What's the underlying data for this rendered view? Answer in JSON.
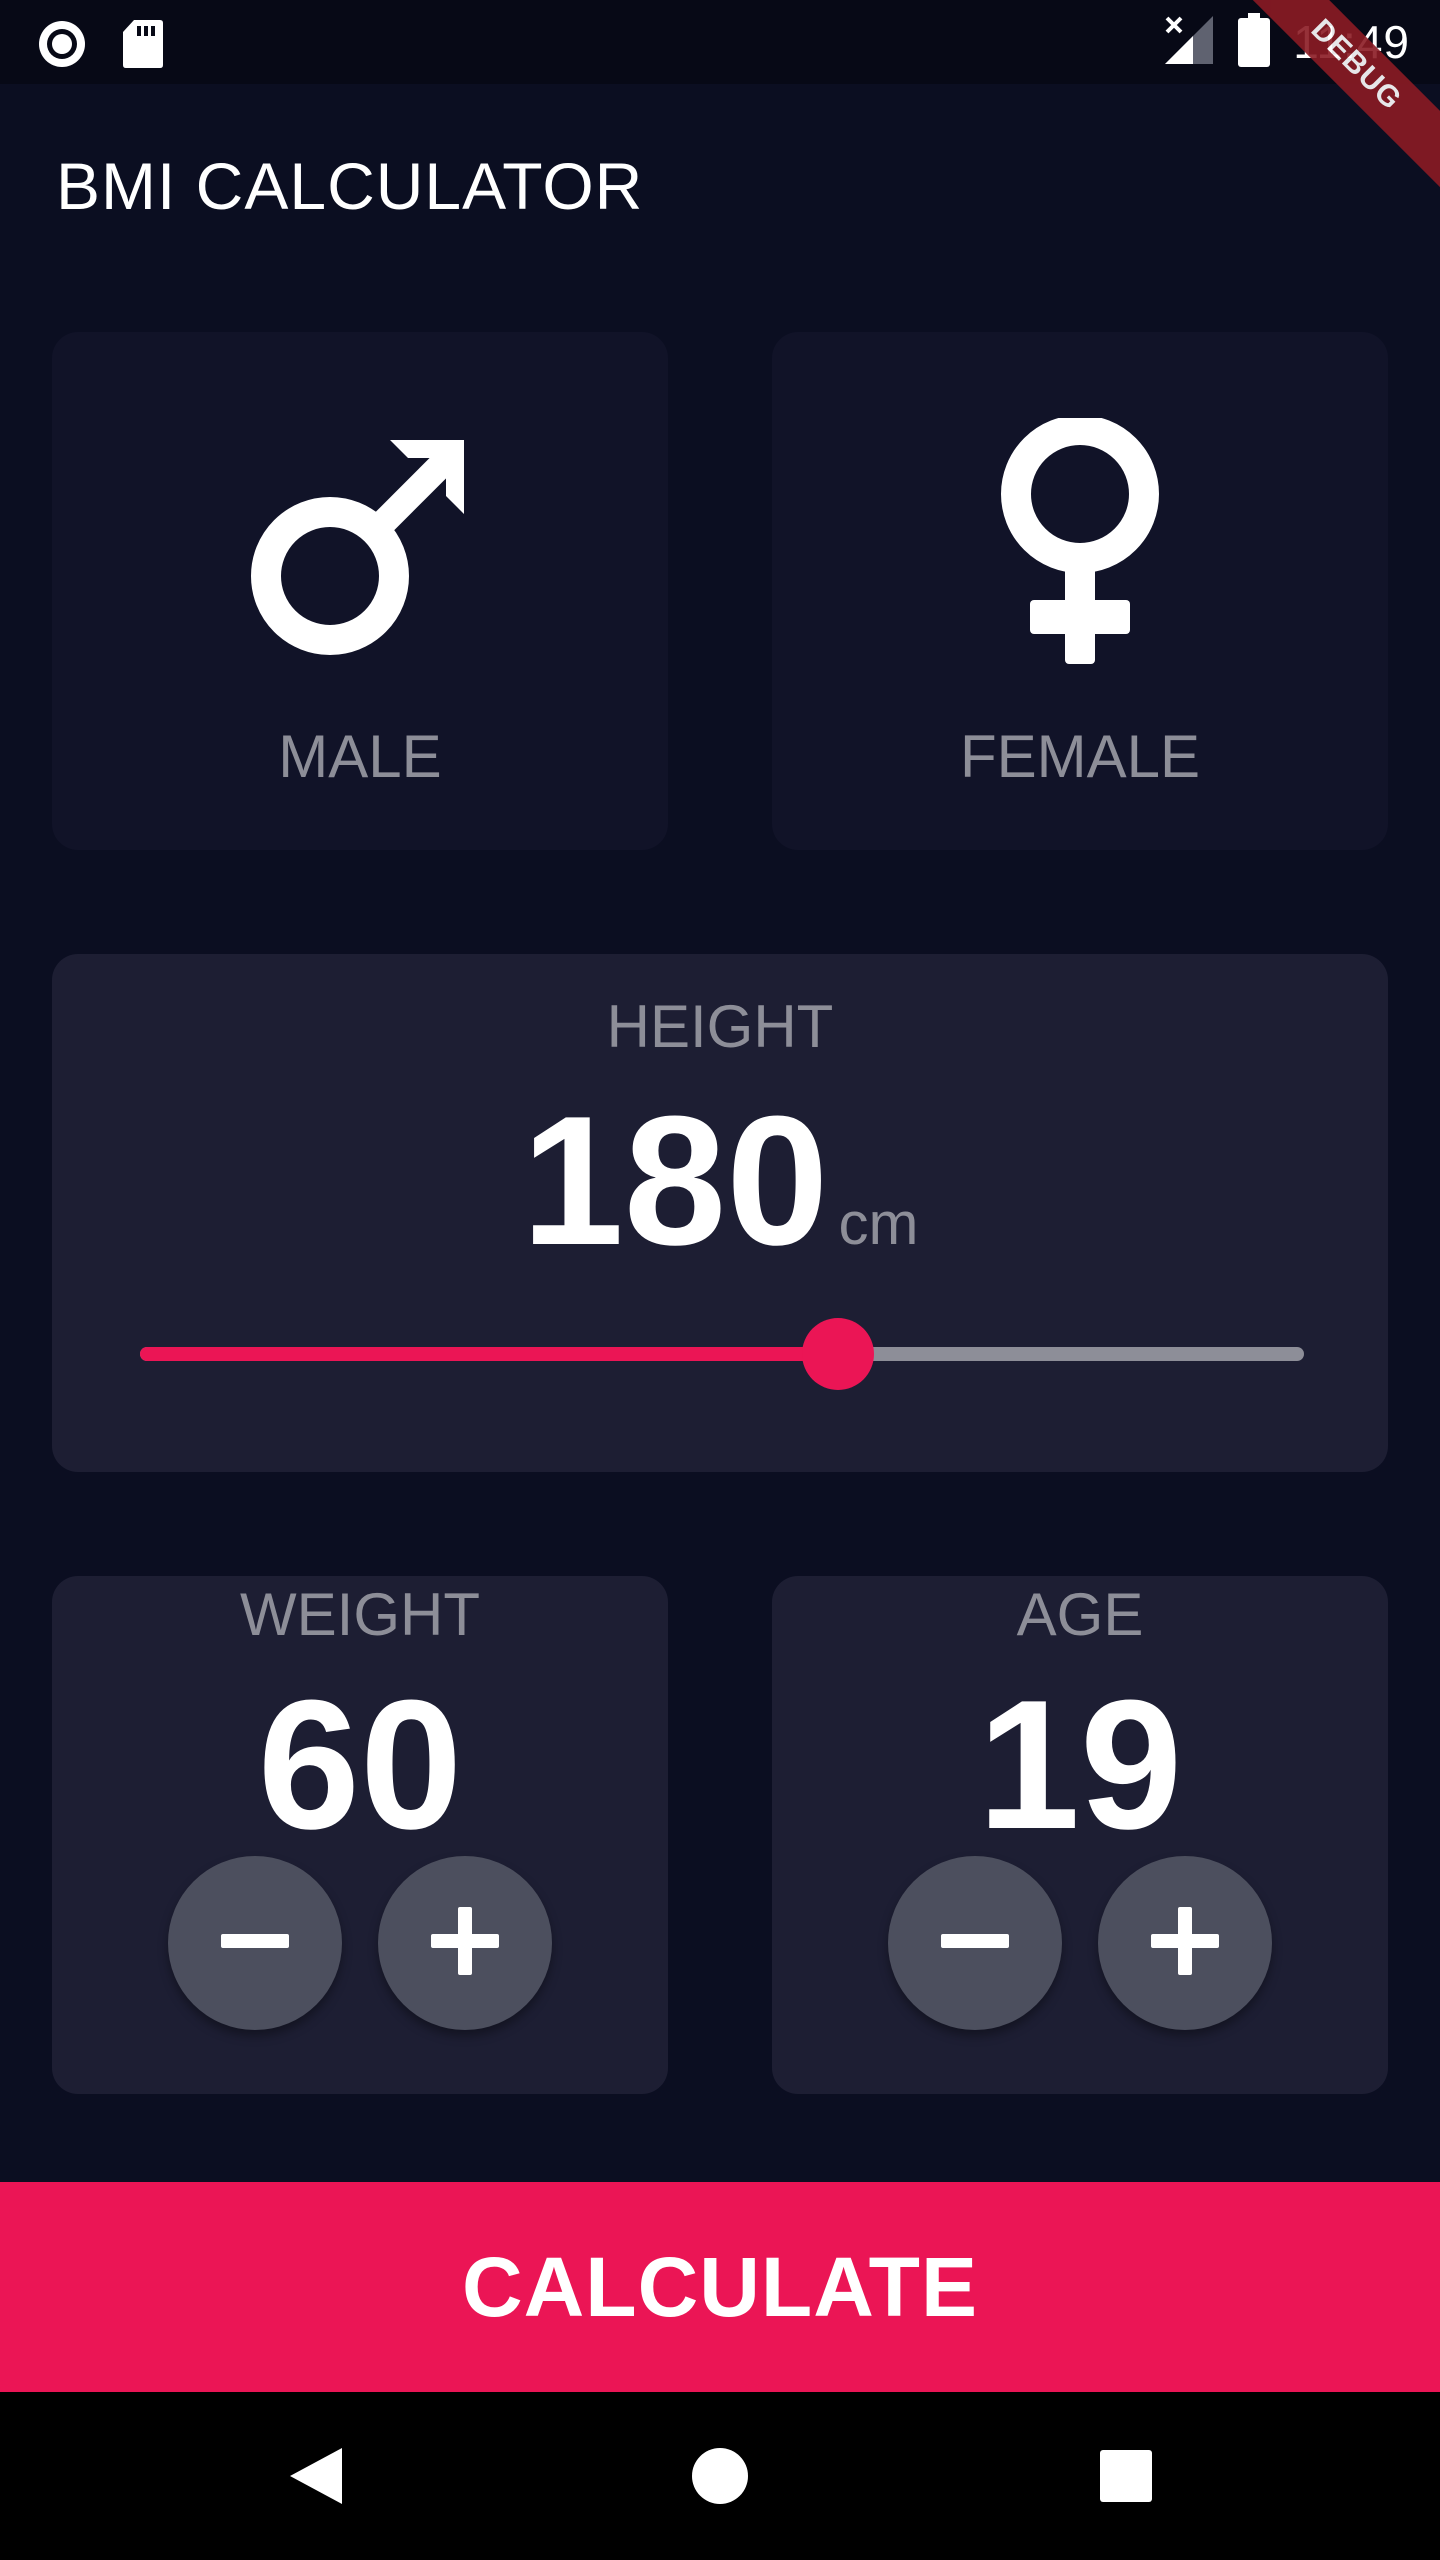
{
  "status_bar": {
    "time": "11:49",
    "icons": [
      "record-icon",
      "sd-card-icon",
      "no-signal-icon",
      "battery-icon"
    ]
  },
  "debug_banner": "DEBUG",
  "app_bar": {
    "title": "BMI CALCULATOR"
  },
  "gender": {
    "male_label": "MALE",
    "female_label": "FEMALE",
    "male_icon": "mars-icon",
    "female_icon": "venus-icon"
  },
  "height": {
    "label": "HEIGHT",
    "value": "180",
    "unit": "cm",
    "slider_min": 120,
    "slider_max": 220,
    "slider_value": 180
  },
  "weight": {
    "label": "WEIGHT",
    "value": "60",
    "minus_icon": "minus-icon",
    "plus_icon": "plus-icon"
  },
  "age": {
    "label": "AGE",
    "value": "19",
    "minus_icon": "minus-icon",
    "plus_icon": "plus-icon"
  },
  "calculate_button": {
    "label": "CALCULATE"
  },
  "nav_bar": {
    "icons": [
      "back-icon",
      "home-icon",
      "recents-icon"
    ]
  },
  "colors": {
    "background": "#0b0e21",
    "inactive_card": "#111328",
    "active_card": "#1d1e33",
    "accent": "#eb1555",
    "label_gray": "#8d8e98",
    "round_button": "#4c4f5e"
  }
}
